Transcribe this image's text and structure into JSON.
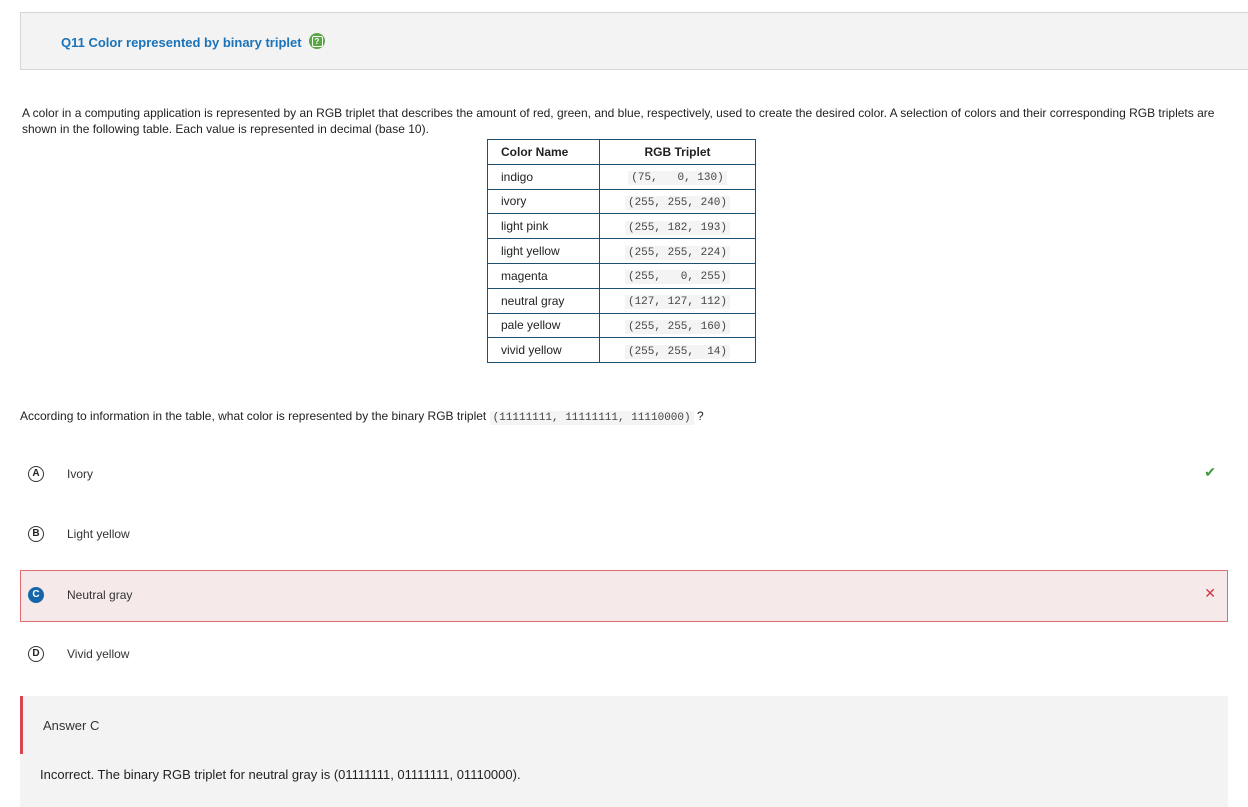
{
  "question": {
    "title": "Q11 Color represented by binary triplet",
    "help_icon": "help-icon",
    "stem": "A color in a computing application is represented by an RGB triplet that describes the amount of red, green, and blue, respectively, used to create the desired color. A selection of colors and their corresponding RGB triplets are shown in the following table. Each value is represented in decimal (base 10).",
    "prompt_before": "According to information in the table, what color is represented by the binary RGB triplet ",
    "prompt_code": "(11111111, 11111111, 11110000)",
    "prompt_after": " ?"
  },
  "table": {
    "headers": [
      "Color Name",
      "RGB Triplet"
    ],
    "rows": [
      {
        "name": "indigo",
        "rgb": "(75,   0, 130)"
      },
      {
        "name": "ivory",
        "rgb": "(255, 255, 240)"
      },
      {
        "name": "light pink",
        "rgb": "(255, 182, 193)"
      },
      {
        "name": "light yellow",
        "rgb": "(255, 255, 224)"
      },
      {
        "name": "magenta",
        "rgb": "(255,   0, 255)"
      },
      {
        "name": "neutral gray",
        "rgb": "(127, 127, 112)"
      },
      {
        "name": "pale yellow",
        "rgb": "(255, 255, 160)"
      },
      {
        "name": "vivid yellow",
        "rgb": "(255, 255,  14)"
      }
    ]
  },
  "options": [
    {
      "letter": "A",
      "label": "Ivory",
      "mark": "✔",
      "state": "correct"
    },
    {
      "letter": "B",
      "label": "Light yellow",
      "mark": "",
      "state": ""
    },
    {
      "letter": "C",
      "label": "Neutral gray",
      "mark": "✕",
      "state": "selected-incorrect"
    },
    {
      "letter": "D",
      "label": "Vivid yellow",
      "mark": "",
      "state": ""
    }
  ],
  "answer": {
    "label": "Answer C",
    "explanation": "Incorrect. The binary RGB triplet for neutral gray is  (01111111, 01111111, 01110000)."
  },
  "colors": {
    "title": "#1a73b8",
    "help_icon": "#5aa845",
    "selected_bg": "#f5e9ea",
    "selected_border": "#e06b74",
    "correct": "#3a9a3a",
    "incorrect": "#d4333f"
  }
}
